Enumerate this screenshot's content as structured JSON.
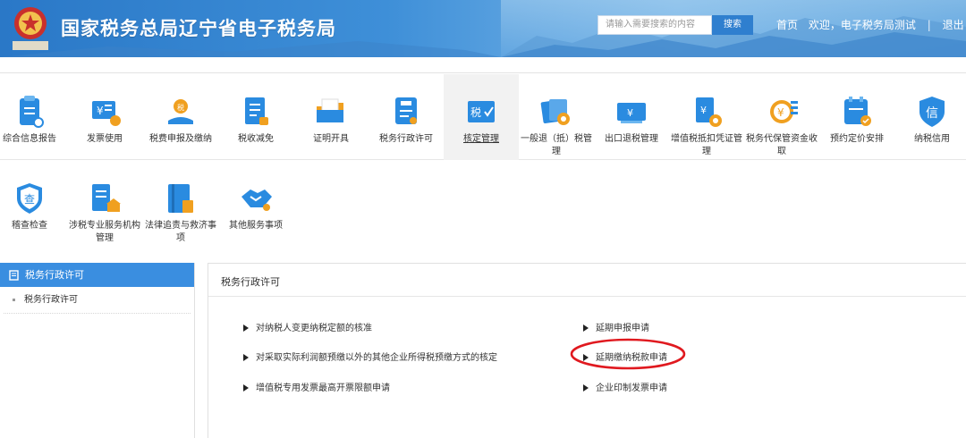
{
  "header": {
    "site_title": "国家税务总局辽宁省电子税务局",
    "search_placeholder": "请输入需要搜索的内容",
    "search_button": "搜索",
    "home_link": "首页",
    "welcome_text": "欢迎，电子税务局测试",
    "separator": "|",
    "logout_link": "退出",
    "logo_text": "中国税务"
  },
  "menu": {
    "row1": [
      {
        "label": "综合信息报告",
        "icon": "report-icon",
        "color": "#2a8be0"
      },
      {
        "label": "发票使用",
        "icon": "invoice-icon",
        "color": "#2a8be0"
      },
      {
        "label": "税费申报及缴纳",
        "icon": "tax-declare-icon",
        "color": "#2a8be0"
      },
      {
        "label": "税收减免",
        "icon": "tax-reduction-icon",
        "color": "#2a8be0"
      },
      {
        "label": "证明开具",
        "icon": "certificate-icon",
        "color": "#2a8be0"
      },
      {
        "label": "税务行政许可",
        "icon": "admin-license-icon",
        "color": "#2a8be0"
      },
      {
        "label": "核定管理",
        "icon": "assessment-icon",
        "color": "#2a8be0",
        "active": true
      },
      {
        "label": "一般退（抵）税管理",
        "icon": "refund-icon",
        "color": "#2a8be0"
      },
      {
        "label": "出口退税管理",
        "icon": "export-refund-icon",
        "color": "#2a8be0"
      },
      {
        "label": "增值税抵扣凭证管理",
        "icon": "vat-deduction-icon",
        "color": "#2a8be0"
      },
      {
        "label": "税务代保管资金收取",
        "icon": "custody-fund-icon",
        "color": "#2a8be0"
      },
      {
        "label": "预约定价安排",
        "icon": "pricing-icon",
        "color": "#2a8be0"
      },
      {
        "label": "纳税信用",
        "icon": "credit-icon",
        "color": "#2a8be0"
      }
    ],
    "row2": [
      {
        "label": "稽查检查",
        "icon": "audit-shield-icon",
        "color": "#2a8be0"
      },
      {
        "label": "涉税专业服务机构管理",
        "icon": "institution-icon",
        "color": "#2a8be0"
      },
      {
        "label": "法律追责与救济事项",
        "icon": "law-book-icon",
        "color": "#2a8be0"
      },
      {
        "label": "其他服务事项",
        "icon": "handshake-icon",
        "color": "#2a8be0"
      }
    ]
  },
  "sidebar": {
    "title": "税务行政许可",
    "items": [
      {
        "label": "税务行政许可"
      }
    ]
  },
  "panel": {
    "title": "税务行政许可",
    "links_left": [
      "对纳税人变更纳税定额的核准",
      "对采取实际利润额预缴以外的其他企业所得税预缴方式的核定",
      "增值税专用发票最高开票限额申请"
    ],
    "links_right": [
      "延期申报申请",
      "延期缴纳税款申请",
      "企业印制发票申请"
    ]
  },
  "colors": {
    "accent": "#3a8ee0",
    "highlight": "#e0191f"
  }
}
